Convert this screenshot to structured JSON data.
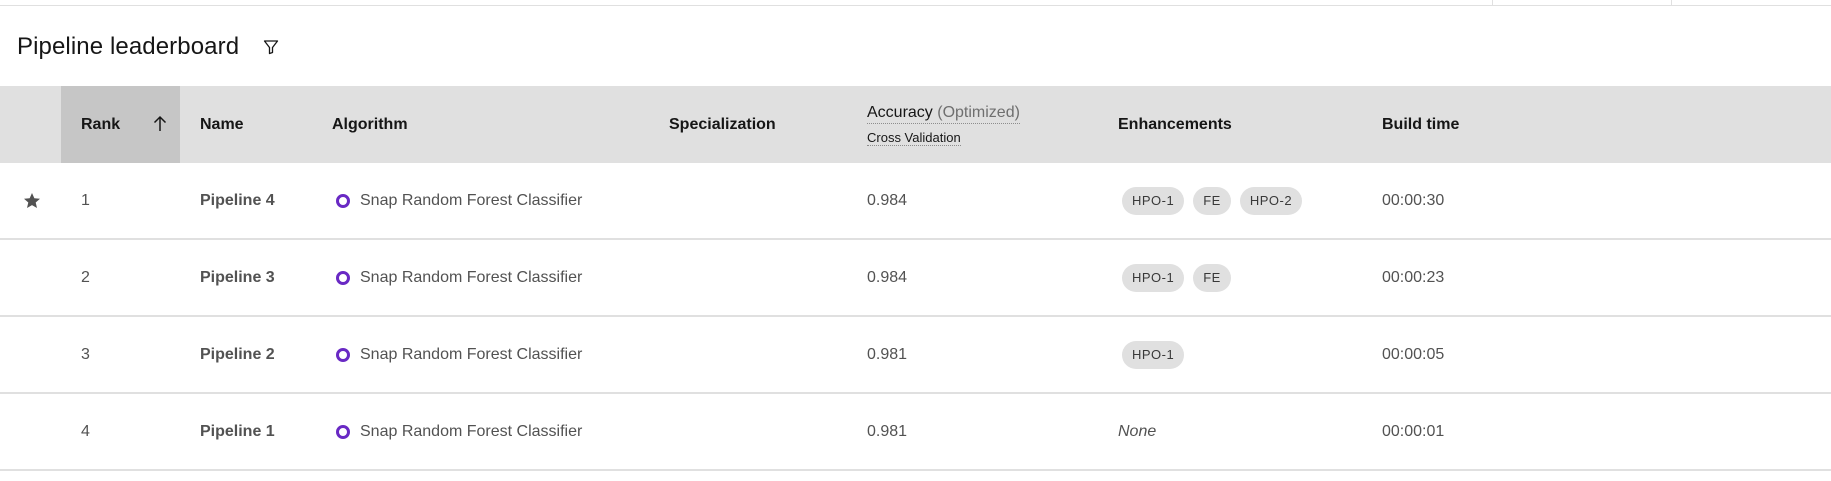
{
  "header": {
    "title": "Pipeline leaderboard"
  },
  "columns": {
    "rank": "Rank",
    "name": "Name",
    "algorithm": "Algorithm",
    "specialization": "Specialization",
    "accuracy": "Accuracy",
    "accuracy_suffix": "(Optimized)",
    "accuracy_sub": "Cross Validation",
    "enhancements": "Enhancements",
    "build_time": "Build time"
  },
  "rows": [
    {
      "rank": "1",
      "name": "Pipeline 4",
      "algorithm": "Snap Random Forest Classifier",
      "accuracy": "0.984",
      "enhancements": [
        "HPO-1",
        "FE",
        "HPO-2"
      ],
      "build_time": "00:00:30",
      "starred": true
    },
    {
      "rank": "2",
      "name": "Pipeline 3",
      "algorithm": "Snap Random Forest Classifier",
      "accuracy": "0.984",
      "enhancements": [
        "HPO-1",
        "FE"
      ],
      "build_time": "00:00:23",
      "starred": false
    },
    {
      "rank": "3",
      "name": "Pipeline 2",
      "algorithm": "Snap Random Forest Classifier",
      "accuracy": "0.981",
      "enhancements": [
        "HPO-1"
      ],
      "build_time": "00:00:05",
      "starred": false
    },
    {
      "rank": "4",
      "name": "Pipeline 1",
      "algorithm": "Snap Random Forest Classifier",
      "accuracy": "0.981",
      "enhancements": [],
      "enhancements_empty": "None",
      "build_time": "00:00:01",
      "starred": false
    }
  ],
  "colors": {
    "accent": "#6929c4",
    "header_bg": "#e0e0e0",
    "sorted_col_bg": "#c6c6c6",
    "tag_bg": "#e0e0e0"
  },
  "icons": {
    "filter": "filter-icon",
    "sort": "arrow-up-icon",
    "star": "star-icon",
    "algorithm": "ring-icon"
  }
}
